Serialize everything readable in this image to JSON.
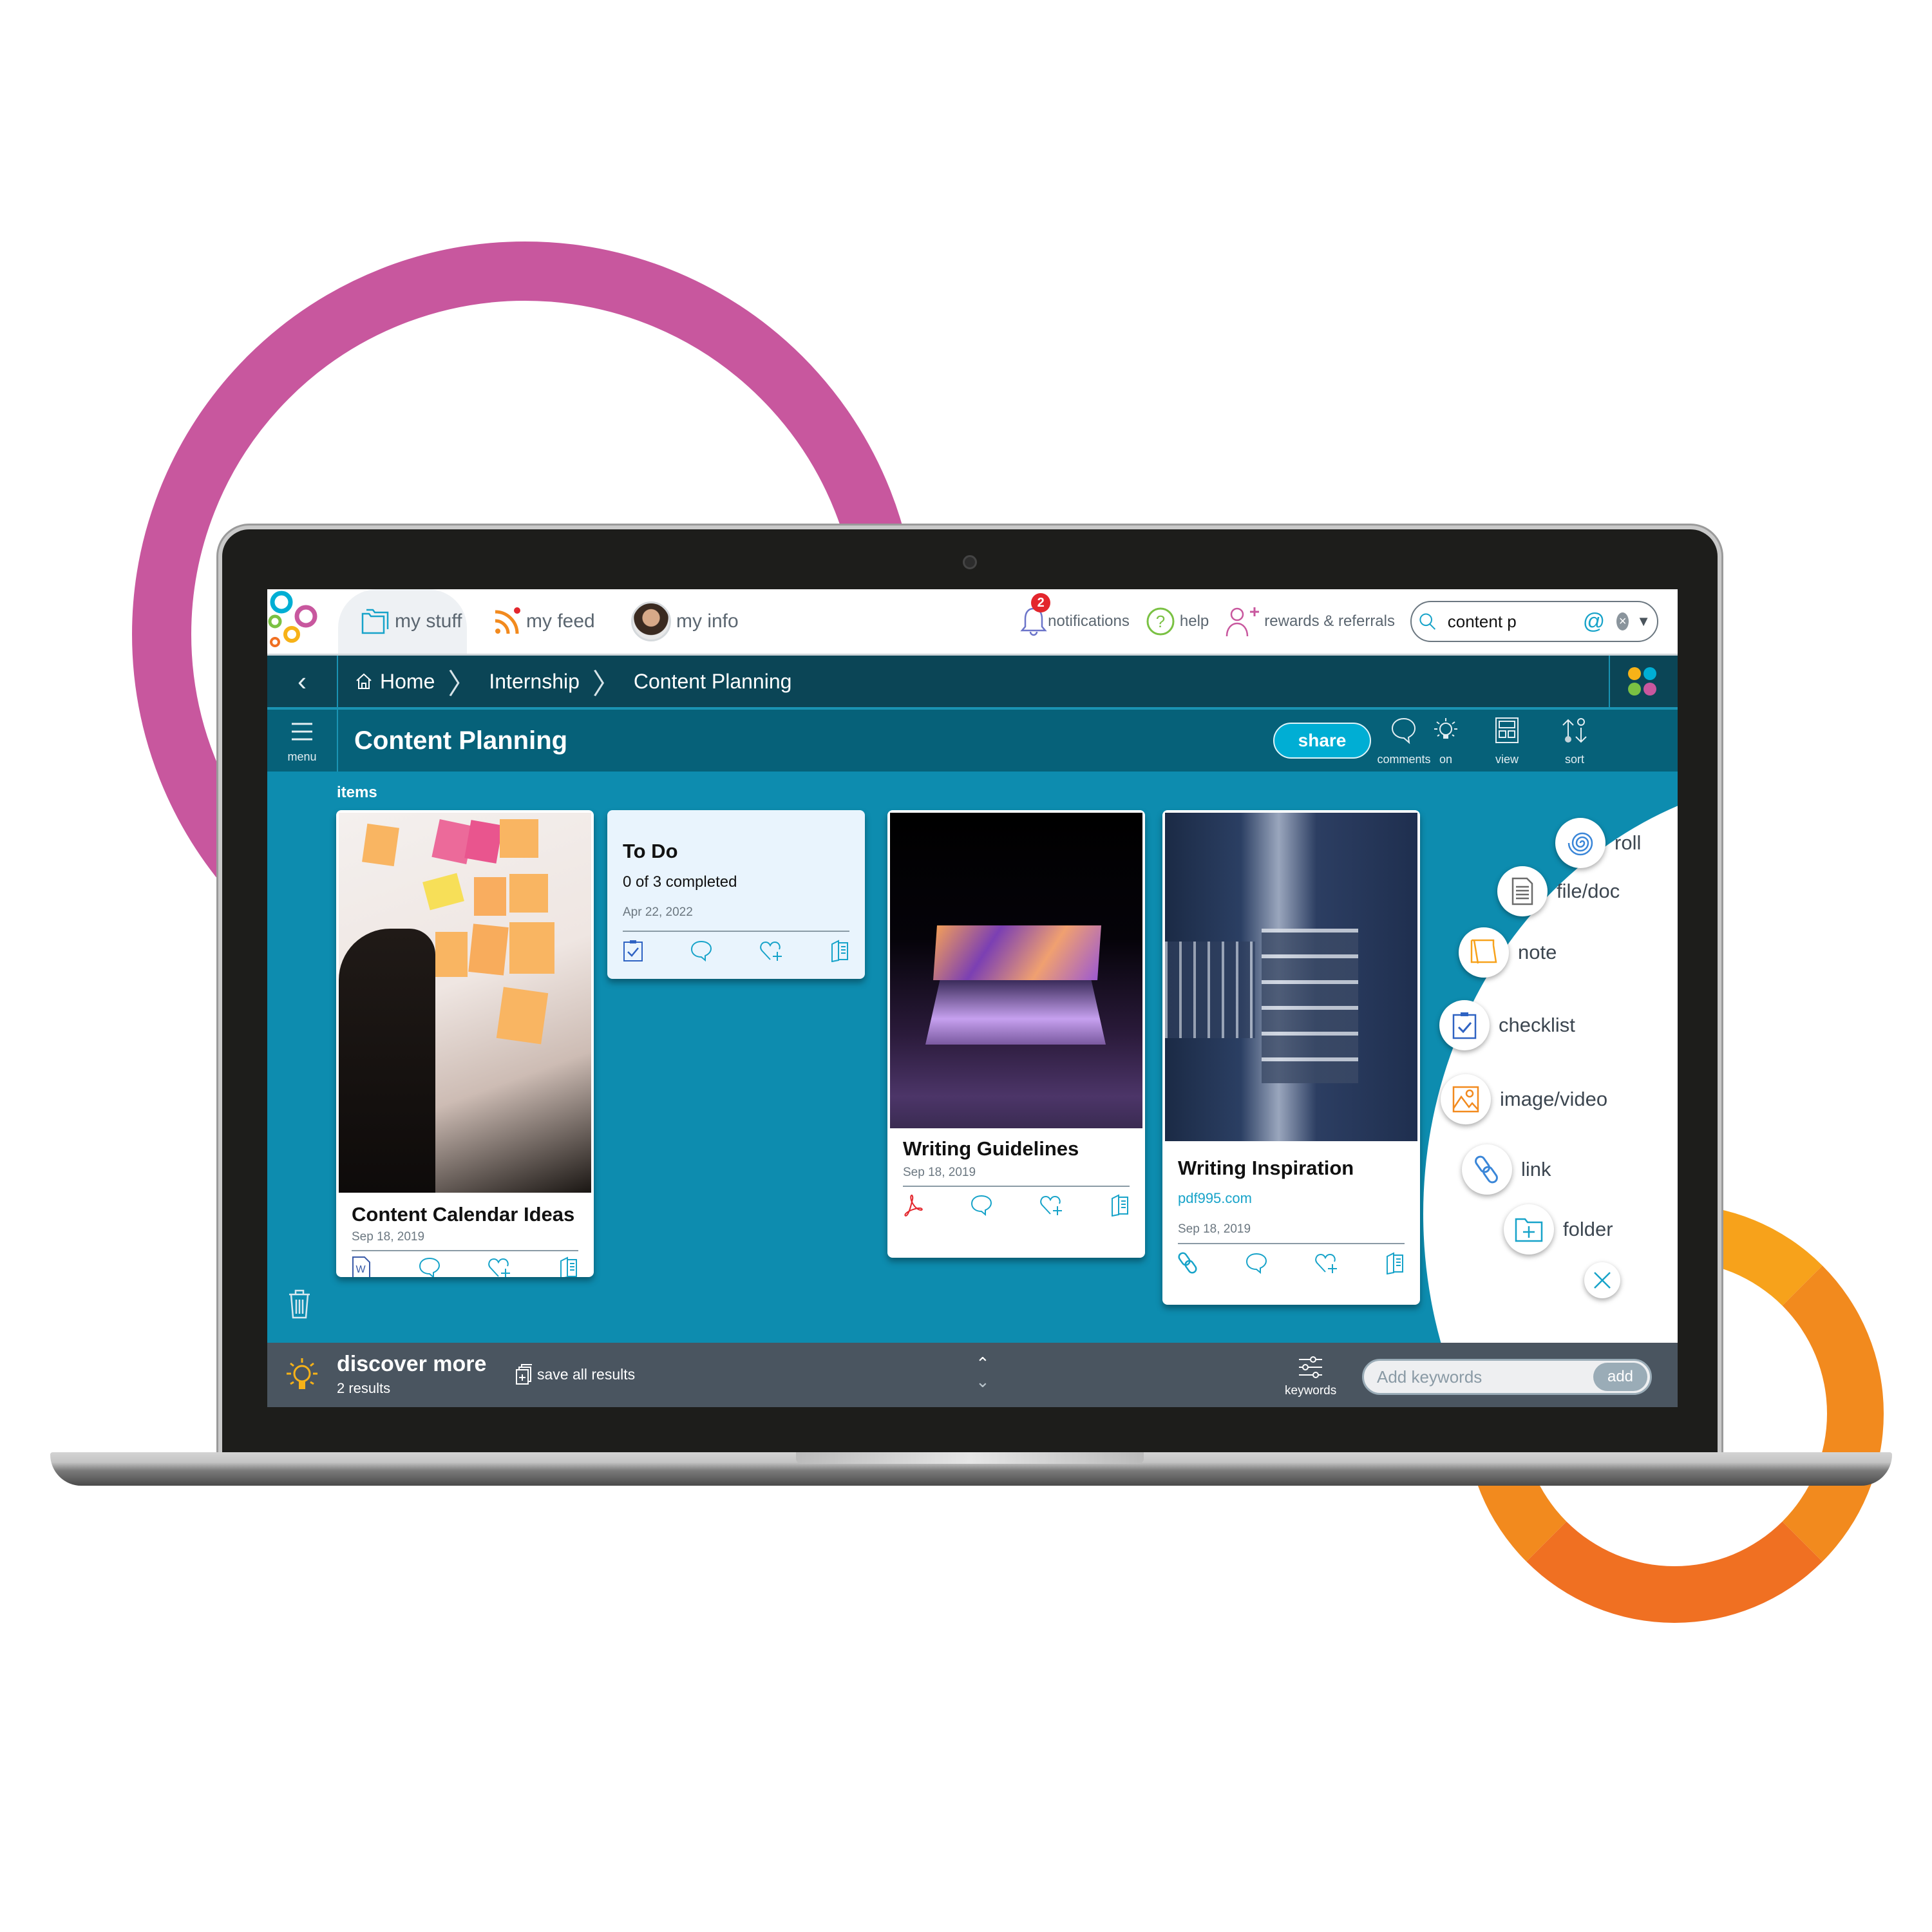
{
  "topbar": {
    "tabs": [
      {
        "label": "my stuff",
        "icon": "folders-icon",
        "active": true
      },
      {
        "label": "my feed",
        "icon": "rss-icon"
      },
      {
        "label": "my info",
        "icon": "avatar"
      }
    ],
    "notifications": {
      "label": "notifications",
      "count": "2"
    },
    "help": {
      "label": "help"
    },
    "rewards": {
      "label": "rewards & referrals"
    },
    "search": {
      "value": "content p",
      "at_symbol": "@",
      "clear": "×",
      "dropdown": "▼"
    }
  },
  "breadcrumb": {
    "back": "‹",
    "items": [
      "Home",
      "Internship",
      "Content Planning"
    ],
    "separator": "〉"
  },
  "apps_dots": {
    "colors": [
      "#f7b218",
      "#00aed4",
      "#7ac143",
      "#c8579e"
    ]
  },
  "titlebar": {
    "menu_label": "menu",
    "title": "Content Planning",
    "share_label": "share",
    "tools": [
      {
        "label": "comments",
        "icon": "comment-icon"
      },
      {
        "label": "on",
        "icon": "lightbulb-icon"
      },
      {
        "label": "view",
        "icon": "layout-icon"
      },
      {
        "label": "sort",
        "icon": "sort-icon"
      }
    ]
  },
  "content": {
    "section_label": "items",
    "cards": [
      {
        "title": "Content Calendar Ideas",
        "date": "Sep 18, 2019",
        "type_icon": "word-doc-icon",
        "image": "sticky-notes-photo"
      },
      {
        "title": "To Do",
        "subtitle": "0 of 3 completed",
        "date": "Apr 22, 2022",
        "type_icon": "checklist-icon"
      },
      {
        "title": "Writing Guidelines",
        "date": "Sep 18, 2019",
        "type_icon": "pdf-icon",
        "image": "laptop-photo"
      },
      {
        "title": "Writing Inspiration",
        "link": "pdf995.com",
        "date": "Sep 18, 2019",
        "type_icon": "link-icon",
        "image": "library-photo"
      }
    ]
  },
  "add_menu": {
    "items": [
      {
        "label": "roll",
        "icon": "spiral-icon"
      },
      {
        "label": "file/doc",
        "icon": "document-icon"
      },
      {
        "label": "note",
        "icon": "note-icon"
      },
      {
        "label": "checklist",
        "icon": "checklist-icon"
      },
      {
        "label": "image/video",
        "icon": "image-icon"
      },
      {
        "label": "link",
        "icon": "link-icon"
      },
      {
        "label": "folder",
        "icon": "folder-add-icon"
      }
    ],
    "close": "×"
  },
  "discover": {
    "title": "discover more",
    "count": "2 results",
    "save_all": "save all results",
    "keywords_label": "keywords",
    "keywords_placeholder": "Add keywords",
    "add_label": "add"
  },
  "colors": {
    "brand_teal": "#0d8caf",
    "dark_teal": "#0b4556",
    "title_teal": "#066179",
    "accent_cyan": "#00aed4",
    "discover_gray": "#4a5560"
  }
}
